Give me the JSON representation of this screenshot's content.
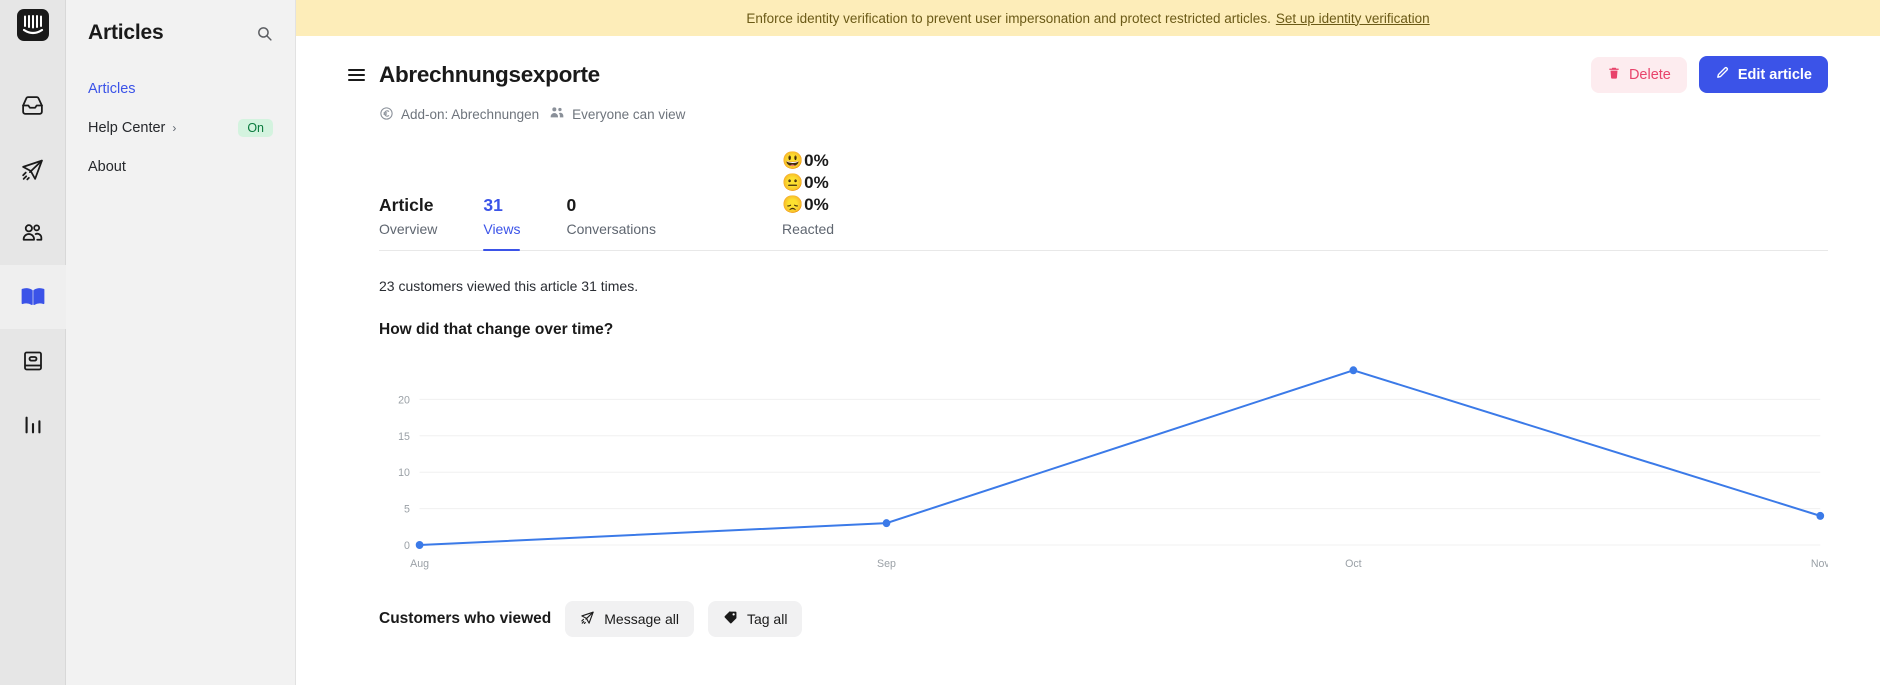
{
  "rail": {
    "logo_icon": "intercom-logo-icon",
    "items": [
      {
        "icon": "inbox-icon",
        "name": "inbox"
      },
      {
        "icon": "send-icon",
        "name": "outbound"
      },
      {
        "icon": "contacts-icon",
        "name": "contacts"
      },
      {
        "icon": "book-icon",
        "name": "articles",
        "active": true
      },
      {
        "icon": "knowledge-icon",
        "name": "knowledge"
      },
      {
        "icon": "bar-chart-icon",
        "name": "reports"
      }
    ]
  },
  "sidebar": {
    "title": "Articles",
    "search_icon": "search-icon",
    "items": [
      {
        "label": "Articles",
        "selected": true
      },
      {
        "label": "Help Center",
        "chevron": "›",
        "badge": "On"
      },
      {
        "label": "About"
      }
    ]
  },
  "banner": {
    "text": "Enforce identity verification to prevent user impersonation and protect restricted articles.",
    "link": "Set up identity verification"
  },
  "header": {
    "menu_icon": "hamburger-menu-icon",
    "title": "Abrechnungsexporte",
    "delete_label": "Delete",
    "delete_icon": "trash-icon",
    "edit_label": "Edit article",
    "edit_icon": "pencil-icon",
    "accent": "#3b53e8",
    "danger": "#e8436b"
  },
  "meta": {
    "addon_icon": "euro-circle-icon",
    "addon": "Add-on: Abrechnungen",
    "audience_icon": "people-icon",
    "audience": "Everyone can view"
  },
  "tabs": [
    {
      "value": "Article",
      "label": "Overview",
      "active": false
    },
    {
      "value": "31",
      "label": "Views",
      "active": true
    },
    {
      "value": "0",
      "label": "Conversations",
      "active": false
    }
  ],
  "reactions": {
    "label": "Reacted",
    "items": [
      {
        "emoji": "😃",
        "name": "happy-reaction",
        "value": "0%"
      },
      {
        "emoji": "😐",
        "name": "neutral-reaction",
        "value": "0%"
      },
      {
        "emoji": "😞",
        "name": "sad-reaction",
        "value": "0%"
      }
    ]
  },
  "stats": {
    "summary": "23 customers viewed this article 31 times.",
    "chart_title": "How did that change over time?"
  },
  "bottom": {
    "title": "Customers who viewed",
    "message_all": "Message all",
    "message_icon": "send-icon",
    "tag_all": "Tag all",
    "tag_icon": "tag-icon"
  },
  "chart_data": {
    "type": "line",
    "title": "How did that change over time?",
    "x": [
      "Aug",
      "Sep",
      "Oct",
      "Nov"
    ],
    "categories": [
      "Aug",
      "Sep",
      "Oct",
      "Nov"
    ],
    "values": [
      0,
      3,
      24,
      4
    ],
    "series": [
      {
        "name": "Views",
        "values": [
          0,
          3,
          24,
          4
        ],
        "color": "#3b7ae8"
      }
    ],
    "yticks": [
      0,
      5,
      10,
      15,
      20
    ],
    "ylim": [
      0,
      25
    ],
    "xlabel": "",
    "ylabel": "",
    "grid": true,
    "legend": false,
    "marker": "circle",
    "line_color": "#3b7ae8"
  }
}
